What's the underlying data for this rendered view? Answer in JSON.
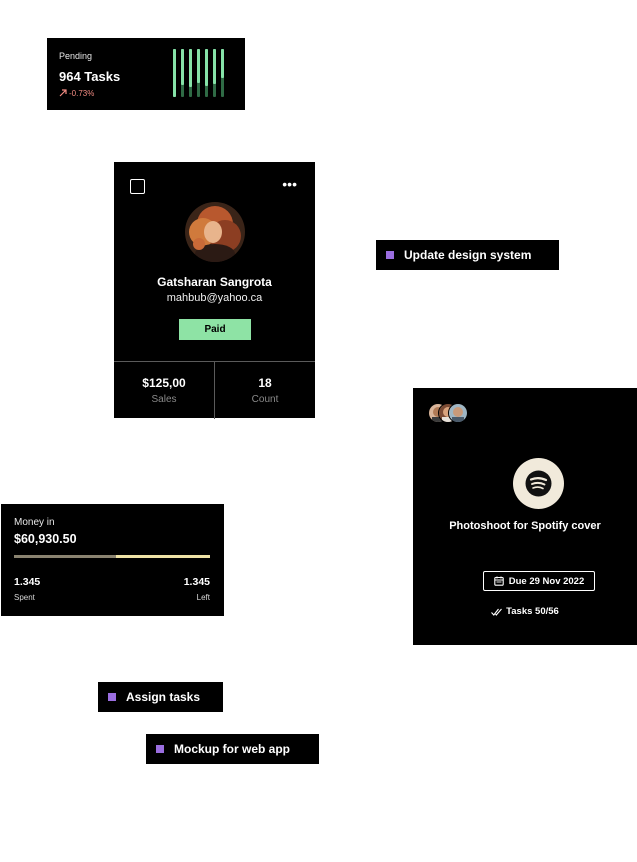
{
  "pending": {
    "label": "Pending",
    "value": "964 Tasks",
    "delta": "-0.73%",
    "bar_levels": [
      1.0,
      0.75,
      0.8,
      0.7,
      0.78,
      0.72,
      0.6
    ],
    "colors": {
      "bar": "#86e3a8",
      "negative": "#f28b82"
    }
  },
  "profile": {
    "name": "Gatsharan Sangrota",
    "email": "mahbub@yahoo.ca",
    "status": "Paid",
    "stats": [
      {
        "value": "$125,00",
        "label": "Sales"
      },
      {
        "value": "18",
        "label": "Count"
      }
    ],
    "colors": {
      "status_bg": "#8ee3a5"
    }
  },
  "chips": {
    "update": "Update design system",
    "assign": "Assign tasks",
    "mockup": "Mockup for web app",
    "accent": "#9b6ee0"
  },
  "spotify": {
    "title": "Photoshoot for Spotify cover",
    "due": "Due 29 Nov 2022",
    "tasks": "Tasks 50/56",
    "icons": [
      "spotify-logo",
      "calendar-icon",
      "double-check-icon"
    ]
  },
  "money": {
    "label": "Money in",
    "value": "$60,930.50",
    "progress": 0.52,
    "spent_value": "1.345",
    "spent_label": "Spent",
    "left_value": "1.345",
    "left_label": "Left",
    "colors": {
      "track": "#efe3a6",
      "fill": "#8a8370"
    }
  }
}
